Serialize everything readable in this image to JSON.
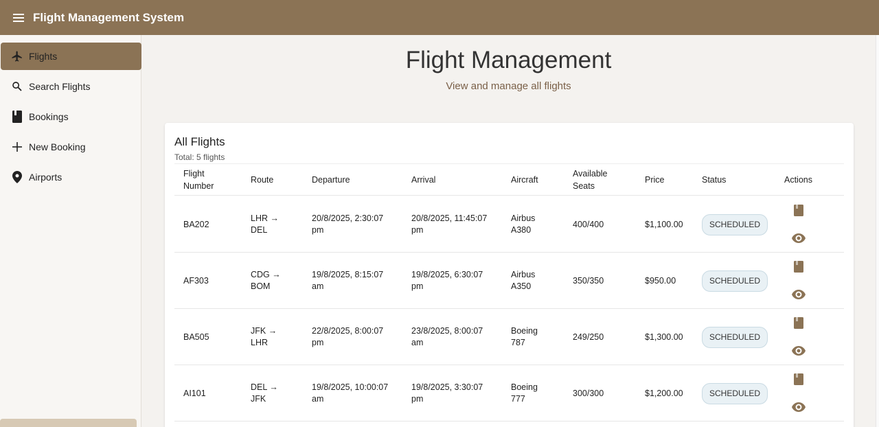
{
  "app": {
    "title": "Flight Management System"
  },
  "sidebar": {
    "items": [
      {
        "label": "Flights",
        "icon": "airplane-icon",
        "active": true
      },
      {
        "label": "Search Flights",
        "icon": "search-icon",
        "active": false
      },
      {
        "label": "Bookings",
        "icon": "book-icon",
        "active": false
      },
      {
        "label": "New Booking",
        "icon": "plus-icon",
        "active": false
      },
      {
        "label": "Airports",
        "icon": "location-pin-icon",
        "active": false
      }
    ]
  },
  "page": {
    "title": "Flight Management",
    "subtitle": "View and manage all flights"
  },
  "card": {
    "title": "All Flights",
    "total": "Total: 5 flights"
  },
  "table": {
    "headers": {
      "flight_number_line1": "Flight",
      "flight_number_line2": "Number",
      "route": "Route",
      "departure": "Departure",
      "arrival": "Arrival",
      "aircraft": "Aircraft",
      "seats_line1": "Available",
      "seats_line2": "Seats",
      "price": "Price",
      "status": "Status",
      "actions": "Actions"
    },
    "rows": [
      {
        "flight": "BA202",
        "route1": "LHR →",
        "route2": "DEL",
        "dep1": "20/8/2025, 2:30:07",
        "dep2": "pm",
        "arr1": "20/8/2025, 11:45:07",
        "arr2": "pm",
        "ac1": "Airbus",
        "ac2": "A380",
        "seats": "400/400",
        "price": "$1,100.00",
        "status": "SCHEDULED"
      },
      {
        "flight": "AF303",
        "route1": "CDG →",
        "route2": "BOM",
        "dep1": "19/8/2025, 8:15:07",
        "dep2": "am",
        "arr1": "19/8/2025, 6:30:07",
        "arr2": "pm",
        "ac1": "Airbus",
        "ac2": "A350",
        "seats": "350/350",
        "price": "$950.00",
        "status": "SCHEDULED"
      },
      {
        "flight": "BA505",
        "route1": "JFK →",
        "route2": "LHR",
        "dep1": "22/8/2025, 8:00:07",
        "dep2": "pm",
        "arr1": "23/8/2025, 8:00:07",
        "arr2": "am",
        "ac1": "Boeing",
        "ac2": "787",
        "seats": "249/250",
        "price": "$1,300.00",
        "status": "SCHEDULED"
      },
      {
        "flight": "AI101",
        "route1": "DEL →",
        "route2": "JFK",
        "dep1": "19/8/2025, 10:00:07",
        "dep2": "am",
        "arr1": "19/8/2025, 3:30:07",
        "arr2": "pm",
        "ac1": "Boeing",
        "ac2": "777",
        "seats": "300/300",
        "price": "$1,200.00",
        "status": "SCHEDULED"
      }
    ]
  },
  "colors": {
    "primary": "#8b7355",
    "background": "#f4f2ef",
    "badge_bg": "#e9f1f5",
    "icon": "#8b7355"
  }
}
